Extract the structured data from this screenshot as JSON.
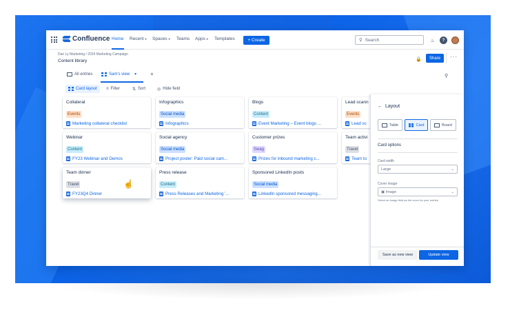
{
  "nav": {
    "logo": "Confluence",
    "items": [
      {
        "label": "Home",
        "chev": ""
      },
      {
        "label": "Recent",
        "chev": "∨"
      },
      {
        "label": "Spaces",
        "chev": "∨"
      },
      {
        "label": "Teams",
        "chev": ""
      },
      {
        "label": "Apps",
        "chev": "∨"
      },
      {
        "label": "Templates",
        "chev": ""
      }
    ],
    "create": "+ Create",
    "search_placeholder": "Search"
  },
  "header": {
    "breadcrumb": "Dan Ly Marketing  /  2024 Marketing Campaign",
    "title": "Content library",
    "share": "Share",
    "more": "···"
  },
  "tabs": {
    "all": "All entries",
    "view": "Sam's view",
    "add": "+"
  },
  "toolbar": {
    "card_layout": "Card layout",
    "filter": "Filter",
    "sort": "Sort",
    "hide": "Hide field"
  },
  "cards": [
    {
      "title": "Collateral",
      "tag": "Events",
      "tag_color": "#fedec8",
      "tag_text": "#a54800",
      "link": "Marketing collateral checklist"
    },
    {
      "title": "Infographics",
      "tag": "Social media",
      "tag_color": "#cce0ff",
      "tag_text": "#0055cc",
      "link": "Infographics"
    },
    {
      "title": "Blogs",
      "tag": "Content",
      "tag_color": "#c6edfb",
      "tag_text": "#206a83",
      "link": "Event Marketing – Event blogs ..."
    },
    {
      "title": "Lead scann",
      "tag": "Events",
      "tag_color": "#fedec8",
      "tag_text": "#a54800",
      "link": "Lead sc"
    },
    {
      "title": "Webinar",
      "tag": "Content",
      "tag_color": "#c6edfb",
      "tag_text": "#206a83",
      "link": "FY23 Webinar and Demos"
    },
    {
      "title": "Social agency",
      "tag": "Social media",
      "tag_color": "#cce0ff",
      "tag_text": "#0055cc",
      "link": "Project poster: Paid social cam..."
    },
    {
      "title": "Customer prizes",
      "tag": "Swag",
      "tag_color": "#dfd8fd",
      "tag_text": "#5e4db2",
      "link": "Prizes for inbound marketing c..."
    },
    {
      "title": "Team activi",
      "tag": "Travel",
      "tag_color": "#dcdfe4",
      "tag_text": "#44546f",
      "link": "Team to"
    },
    {
      "title": "Team dinner",
      "tag": "Travel",
      "tag_color": "#dcdfe4",
      "tag_text": "#44546f",
      "link": "FY23Q4 Dinner"
    },
    {
      "title": "Press release",
      "tag": "Content",
      "tag_color": "#c6edfb",
      "tag_text": "#206a83",
      "link": "Press Releases and Marketing '..."
    },
    {
      "title": "Sponsored LinkedIn posts",
      "tag": "Social media",
      "tag_color": "#cce0ff",
      "tag_text": "#0055cc",
      "link": "LinkedIn sponsored messaging..."
    }
  ],
  "panel": {
    "title": "Layout",
    "back": "←",
    "layouts": [
      "Table",
      "Card",
      "Board"
    ],
    "options_heading": "Card options",
    "card_width_label": "Card width",
    "card_width_value": "Large",
    "cover_label": "Cover image",
    "cover_value": "Image",
    "hint": "Select an image field as the cover for your entries",
    "save_view": "Save as new view",
    "update_view": "Update view"
  }
}
